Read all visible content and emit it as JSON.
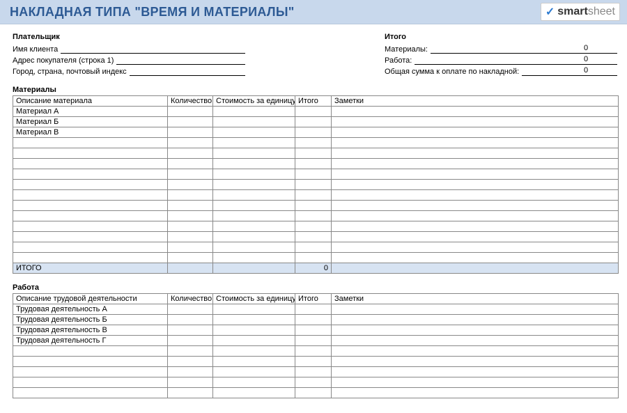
{
  "title": "НАКЛАДНАЯ ТИПА \"ВРЕМЯ И МАТЕРИАЛЫ\"",
  "brand": {
    "bold": "smart",
    "light": "sheet"
  },
  "payer": {
    "heading": "Плательщик",
    "rows": [
      "Имя клиента",
      "Адрес покупателя (строка 1)",
      "Город, страна, почтовый индекс"
    ]
  },
  "summary": {
    "heading": "Итого",
    "rows": [
      {
        "label": "Материалы:",
        "value": "0"
      },
      {
        "label": "Работа:",
        "value": "0"
      },
      {
        "label": "Общая сумма к оплате по накладной:",
        "value": "0"
      }
    ]
  },
  "materials": {
    "heading": "Материалы",
    "columns": [
      "Описание материала",
      "Количество",
      "Стоимость за единицу",
      "Итого",
      "Заметки"
    ],
    "rows": [
      {
        "desc": "Материал A"
      },
      {
        "desc": "Материал Б"
      },
      {
        "desc": "Материал В"
      },
      {},
      {},
      {},
      {},
      {},
      {},
      {},
      {},
      {},
      {},
      {},
      {}
    ],
    "total_label": "ИТОГО",
    "total_value": "0"
  },
  "labor": {
    "heading": "Работа",
    "columns": [
      "Описание трудовой деятельности",
      "Количество",
      "Стоимость за единицу",
      "Итого",
      "Заметки"
    ],
    "rows": [
      {
        "desc": "Трудовая деятельность A"
      },
      {
        "desc": "Трудовая деятельность Б"
      },
      {
        "desc": "Трудовая деятельность В"
      },
      {
        "desc": "Трудовая деятельность Г"
      },
      {},
      {},
      {},
      {},
      {}
    ]
  }
}
